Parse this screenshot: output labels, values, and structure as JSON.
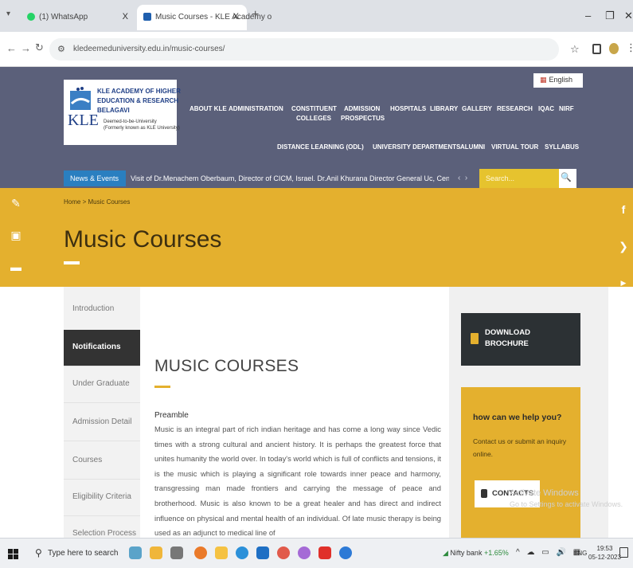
{
  "browser": {
    "tabs": [
      {
        "title": "(1) WhatsApp",
        "active": false
      },
      {
        "title": "Music Courses - KLE Academy o",
        "active": true
      }
    ],
    "close_glyph": "X",
    "new_tab_glyph": "+",
    "url": "kledeemeduniversity.edu.in/music-courses/",
    "window_controls": [
      "–",
      "❐",
      "✕"
    ]
  },
  "site": {
    "logo": {
      "kle": "KLE",
      "line1": "KLE ACADEMY OF HIGHER",
      "line2": "EDUCATION & RESEARCH",
      "line3": "BELAGAVI",
      "line4": "Deemed-to-be-University",
      "line5": "(Formerly known as KLE University)"
    },
    "language": "English",
    "nav_row1": [
      "ABOUT KLE",
      "ADMINISTRATION",
      "CONSTITUENT",
      "ADMISSION",
      "HOSPITALS",
      "LIBRARY",
      "GALLERY",
      "RESEARCH",
      "IQAC",
      "NIRF"
    ],
    "nav_row1_sub": [
      "COLLEGES",
      "PROSPECTUS"
    ],
    "nav_row2": [
      "DISTANCE LEARNING (ODL)",
      "UNIVERSITY DEPARTMENTS",
      "ALUMNI",
      "VIRTUAL TOUR",
      "SYLLABUS"
    ],
    "news_label": "News & Events",
    "news_text": "Visit of Dr.Menachem Oberbaum, Director of CICM, Israel. Dr.Anil Khurana Director General Uc, Cent...",
    "search_placeholder": "Search...",
    "breadcrumb": "Home  >  Music Courses",
    "banner_title": "Music Courses",
    "left_menu": [
      "Introduction",
      "Notifications",
      "Under Graduate",
      "Admission Detail",
      "Courses",
      "Eligibility Criteria",
      "Selection Process"
    ],
    "page_heading": "MUSIC COURSES",
    "section_title": "Preamble",
    "paragraph": "Music is an integral part of rich indian heritage and has come a long way since Vedic times with a strong cultural and ancient history. It is perhaps the greatest force that unites humanity the world over. In today's world which is full of conflicts and tensions, it is the music which is playing a significant role towards inner peace and harmony, transgressing man made frontiers and carrying the message of peace and brotherhood. Music is also known to be a great healer and has direct and indirect influence on physical and mental health of an individual. Of late music therapy is being used as an adjunct to medical line of",
    "download_label": "DOWNLOAD BROCHURE",
    "help_title": "how can we help you?",
    "help_text": "Contact us or submit an inquiry online.",
    "contact_label": "CONTACTS",
    "watermark_line1": "Activate Windows",
    "watermark_line2": "Go to Settings to activate Windows."
  },
  "taskbar": {
    "search_placeholder": "Type here to search",
    "nifty": "Nifty bank",
    "nifty_change": "+1.65%",
    "lang": "ENG",
    "time": "19:53",
    "date": "05-12-2023"
  },
  "colors": {
    "header_bg": "#5b607a",
    "accent_yellow": "#e4b02e",
    "dark_button": "#2c3134",
    "news_blue": "#2a7fc0"
  }
}
